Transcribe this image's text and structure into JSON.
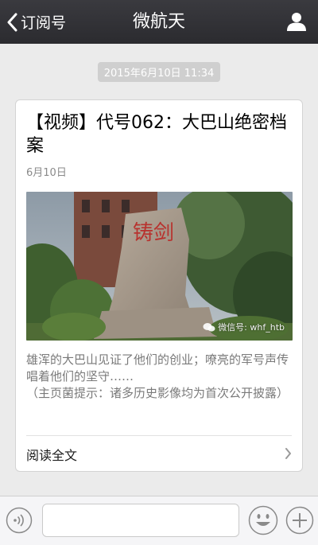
{
  "navbar": {
    "back_label": "订阅号",
    "title": "微航天"
  },
  "message": {
    "timestamp": "2015年6月10日 11:34"
  },
  "article": {
    "title": "【视频】代号062：大巴山绝密档案",
    "date": "6月10日",
    "cover_watermark": "微信号: whf_htb",
    "cover_stone_text": "铸剑",
    "summary_line1": "雄浑的大巴山见证了他们的创业；嘹亮的军号声传唱着他们的坚守……",
    "summary_line2": "（主页菌提示：诸多历史影像均为首次公开披露）",
    "read_more_label": "阅读全文"
  },
  "input_bar": {
    "placeholder": ""
  },
  "colors": {
    "navbar": "#2f2f33",
    "background": "#ebebeb",
    "timestamp_bg": "#cfcfcf"
  }
}
